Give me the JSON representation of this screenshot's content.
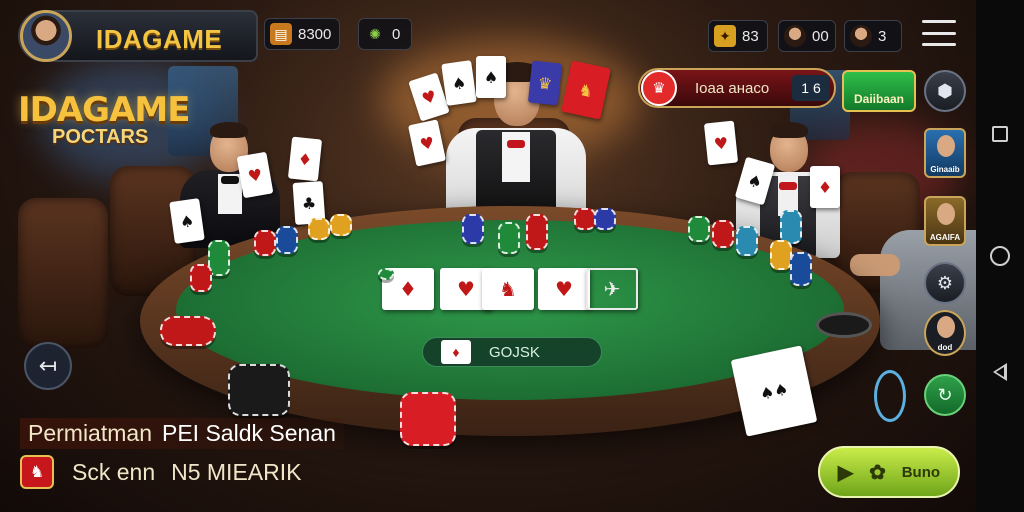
{
  "brand": {
    "name": "IDAGAME"
  },
  "hud": {
    "coins": "8300",
    "gems": "0",
    "stat_a": "83",
    "stat_b": "00",
    "stat_c": "3"
  },
  "logo": {
    "line1": "IDAGAME",
    "line2": "POCTARS"
  },
  "info_banner": {
    "text": "Ioaa aнaco",
    "count": "1 6"
  },
  "store_badge": {
    "label": "Daiibaan"
  },
  "side_players": [
    {
      "label": "Ginaaib"
    },
    {
      "label": "AGAIFA"
    },
    {
      "label": "dod"
    }
  ],
  "pot": {
    "value": "GOJSK"
  },
  "bottom": {
    "line1_a": "Permiatman",
    "line1_b": "PEI Saldk Senan",
    "line2_a": "Sck enn",
    "line2_b": "N5 MIEARIK"
  },
  "play_button": {
    "label": "Buno"
  },
  "icons": {
    "coins": "coin-bag-icon",
    "gems": "gear-gem-icon",
    "menu": "hamburger-menu-icon",
    "back": "back-arrow-icon",
    "chat": "chat-icon",
    "settings": "settings-icon"
  },
  "colors": {
    "felt": "#1d6e33",
    "gold": "#f4c542",
    "play": "#8cc22a",
    "banner_red": "#7a1418"
  }
}
